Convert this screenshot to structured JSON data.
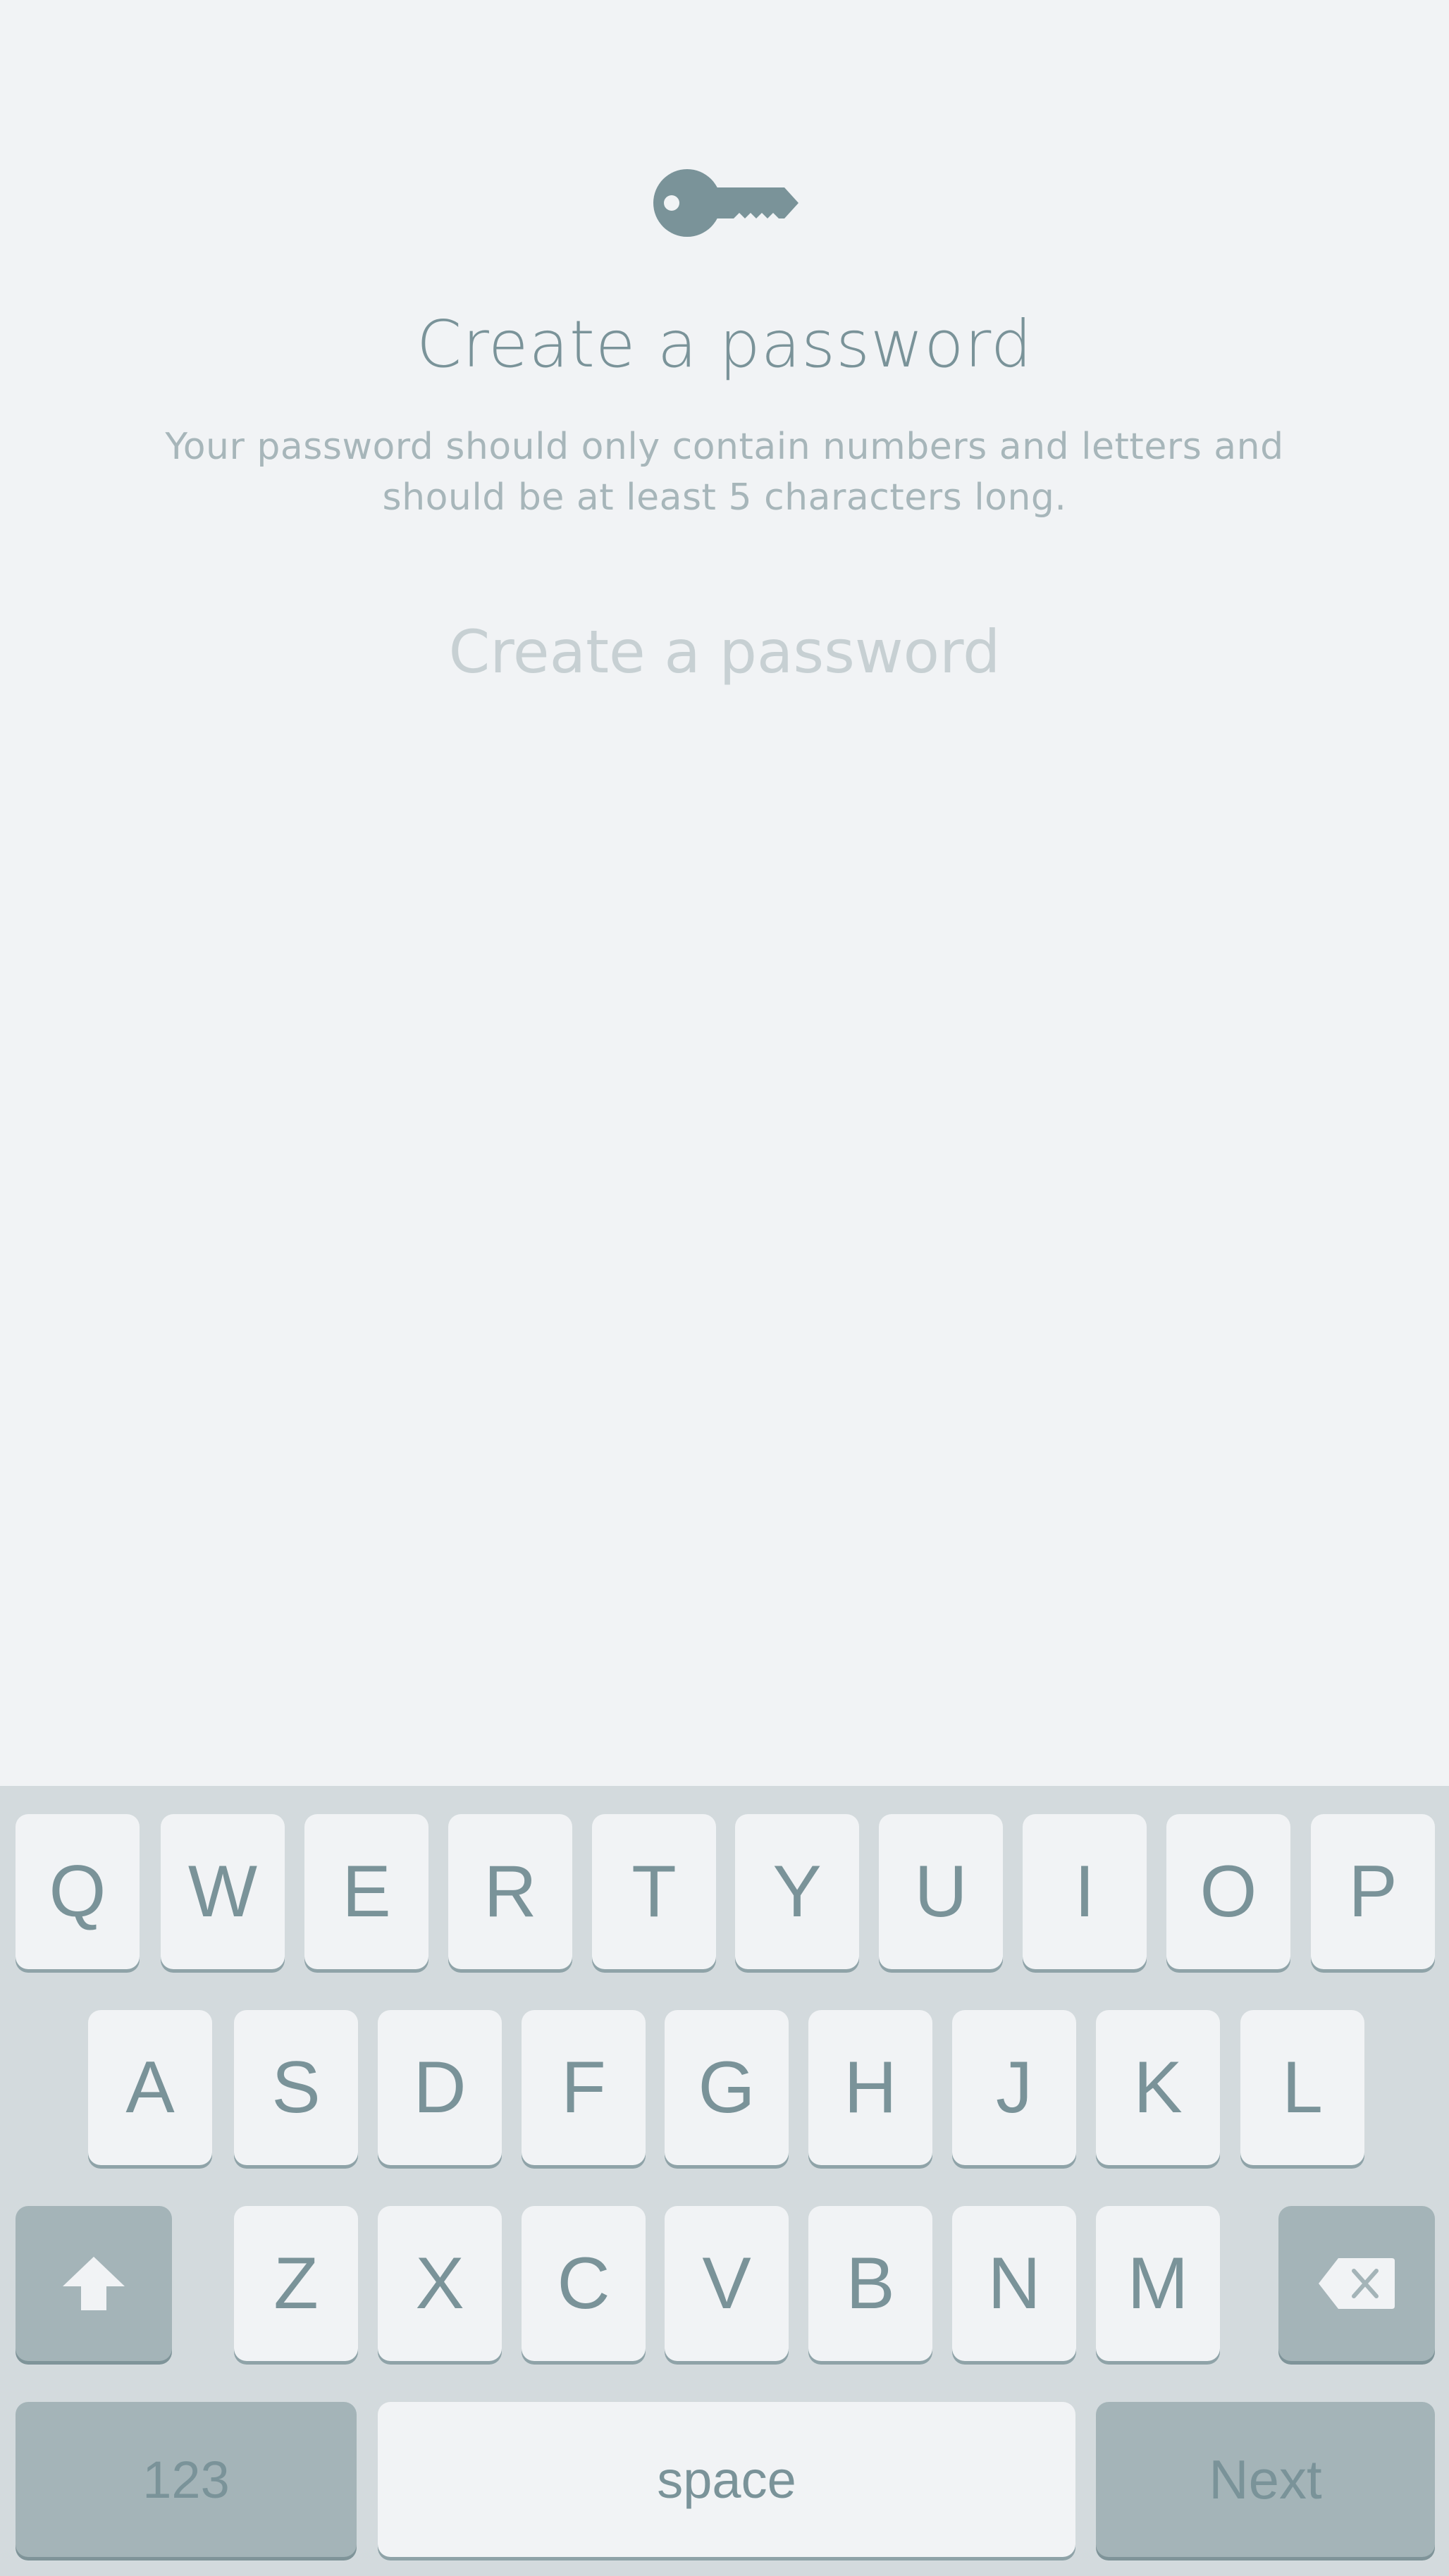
{
  "screen": {
    "title": "Create a password",
    "subtitle": "Your password should only contain numbers and letters and should be at least 5 characters long.",
    "password_input": {
      "placeholder": "Create a password",
      "value": ""
    }
  },
  "keyboard": {
    "row1": [
      "Q",
      "W",
      "E",
      "R",
      "T",
      "Y",
      "U",
      "I",
      "O",
      "P"
    ],
    "row2": [
      "A",
      "S",
      "D",
      "F",
      "G",
      "H",
      "J",
      "K",
      "L"
    ],
    "row3": [
      "Z",
      "X",
      "C",
      "V",
      "B",
      "N",
      "M"
    ],
    "shift_icon": "shift-arrow-icon",
    "backspace_icon": "backspace-icon",
    "numbers_label": "123",
    "space_label": "space",
    "next_label": "Next"
  },
  "colors": {
    "background": "#f1f3f5",
    "accent": "#7a9399",
    "keyboard_bg": "#d3dadd",
    "key_dark": "#a4b4b8"
  }
}
